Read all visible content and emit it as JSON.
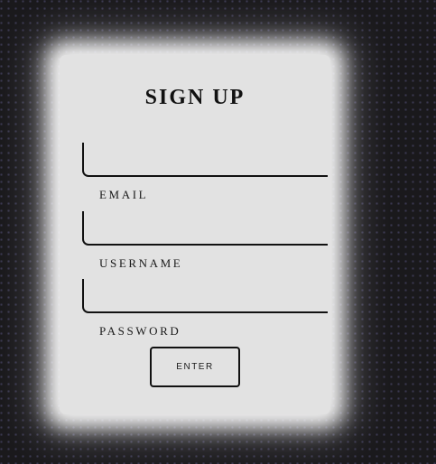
{
  "form": {
    "title": "SIGN UP",
    "fields": [
      {
        "label": "EMAIL",
        "value": ""
      },
      {
        "label": "USERNAME",
        "value": ""
      },
      {
        "label": "PASSWORD",
        "value": ""
      }
    ],
    "submit_label": "ENTER"
  }
}
